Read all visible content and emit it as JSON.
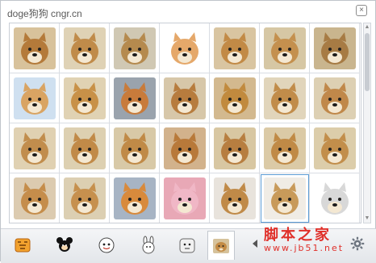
{
  "window": {
    "title": "doge狗狗 cngr.cn"
  },
  "close_icon": "×",
  "emojis": [
    {
      "name": "doge-1",
      "bg": "#d8c29b",
      "fg": "#b47a3a"
    },
    {
      "name": "doge-2",
      "bg": "#dfd2b5",
      "fg": "#c08b4a"
    },
    {
      "name": "doge-3",
      "bg": "#d0c8b3",
      "fg": "#b58a4e"
    },
    {
      "name": "doge-4",
      "bg": "#ffffff",
      "fg": "#e5a86a"
    },
    {
      "name": "doge-5",
      "bg": "#d9c5a1",
      "fg": "#c28a46"
    },
    {
      "name": "doge-6",
      "bg": "#d6c7a4",
      "fg": "#c4904e"
    },
    {
      "name": "doge-7",
      "bg": "#c9b58e",
      "fg": "#a77b44"
    },
    {
      "name": "doge-8",
      "bg": "#cfe0f0",
      "fg": "#d9a463"
    },
    {
      "name": "doge-9",
      "bg": "#e0d2b3",
      "fg": "#c89148"
    },
    {
      "name": "doge-10",
      "bg": "#9aa3ad",
      "fg": "#c87b3b"
    },
    {
      "name": "doge-11",
      "bg": "#d7c7a9",
      "fg": "#b77c3e"
    },
    {
      "name": "doge-12",
      "bg": "#d3b98f",
      "fg": "#c18a3e"
    },
    {
      "name": "doge-13",
      "bg": "#e1d5bb",
      "fg": "#c18c4a"
    },
    {
      "name": "doge-14",
      "bg": "#ddd0b3",
      "fg": "#c0884a"
    },
    {
      "name": "doge-15",
      "bg": "#e0d1b2",
      "fg": "#c18d4d"
    },
    {
      "name": "doge-16",
      "bg": "#ddd0b1",
      "fg": "#c18a48"
    },
    {
      "name": "doge-17",
      "bg": "#d8c9a7",
      "fg": "#c08a47"
    },
    {
      "name": "doge-18",
      "bg": "#d2b28c",
      "fg": "#b8793a"
    },
    {
      "name": "doge-19",
      "bg": "#d8c7a2",
      "fg": "#b77e40"
    },
    {
      "name": "doge-20",
      "bg": "#dbcaa6",
      "fg": "#c08a46"
    },
    {
      "name": "doge-21",
      "bg": "#dccdaa",
      "fg": "#c28e4b"
    },
    {
      "name": "doge-22",
      "bg": "#dccbb0",
      "fg": "#c58d4b"
    },
    {
      "name": "doge-23",
      "bg": "#dccfb2",
      "fg": "#c6904e"
    },
    {
      "name": "doge-24",
      "bg": "#a7b4c4",
      "fg": "#d88a3c"
    },
    {
      "name": "doge-25",
      "bg": "#e8a8b6",
      "fg": "#f0b7c6"
    },
    {
      "name": "doge-26",
      "bg": "#e8e3dc",
      "fg": "#c08a48"
    },
    {
      "name": "doge-27",
      "bg": "#f0ece5",
      "fg": "#c89a5a"
    },
    {
      "name": "doge-28",
      "bg": "#ffffff",
      "fg": "#d8d8d8"
    }
  ],
  "tabs": [
    {
      "name": "tab-tiger",
      "selected": false
    },
    {
      "name": "tab-mickey",
      "selected": false
    },
    {
      "name": "tab-cat-face",
      "selected": false
    },
    {
      "name": "tab-bunny",
      "selected": false
    },
    {
      "name": "tab-cartoon-face",
      "selected": false
    },
    {
      "name": "tab-doge",
      "selected": true
    }
  ],
  "watermark": {
    "top": "脚本之家",
    "bottom": "www.jb51.net"
  }
}
